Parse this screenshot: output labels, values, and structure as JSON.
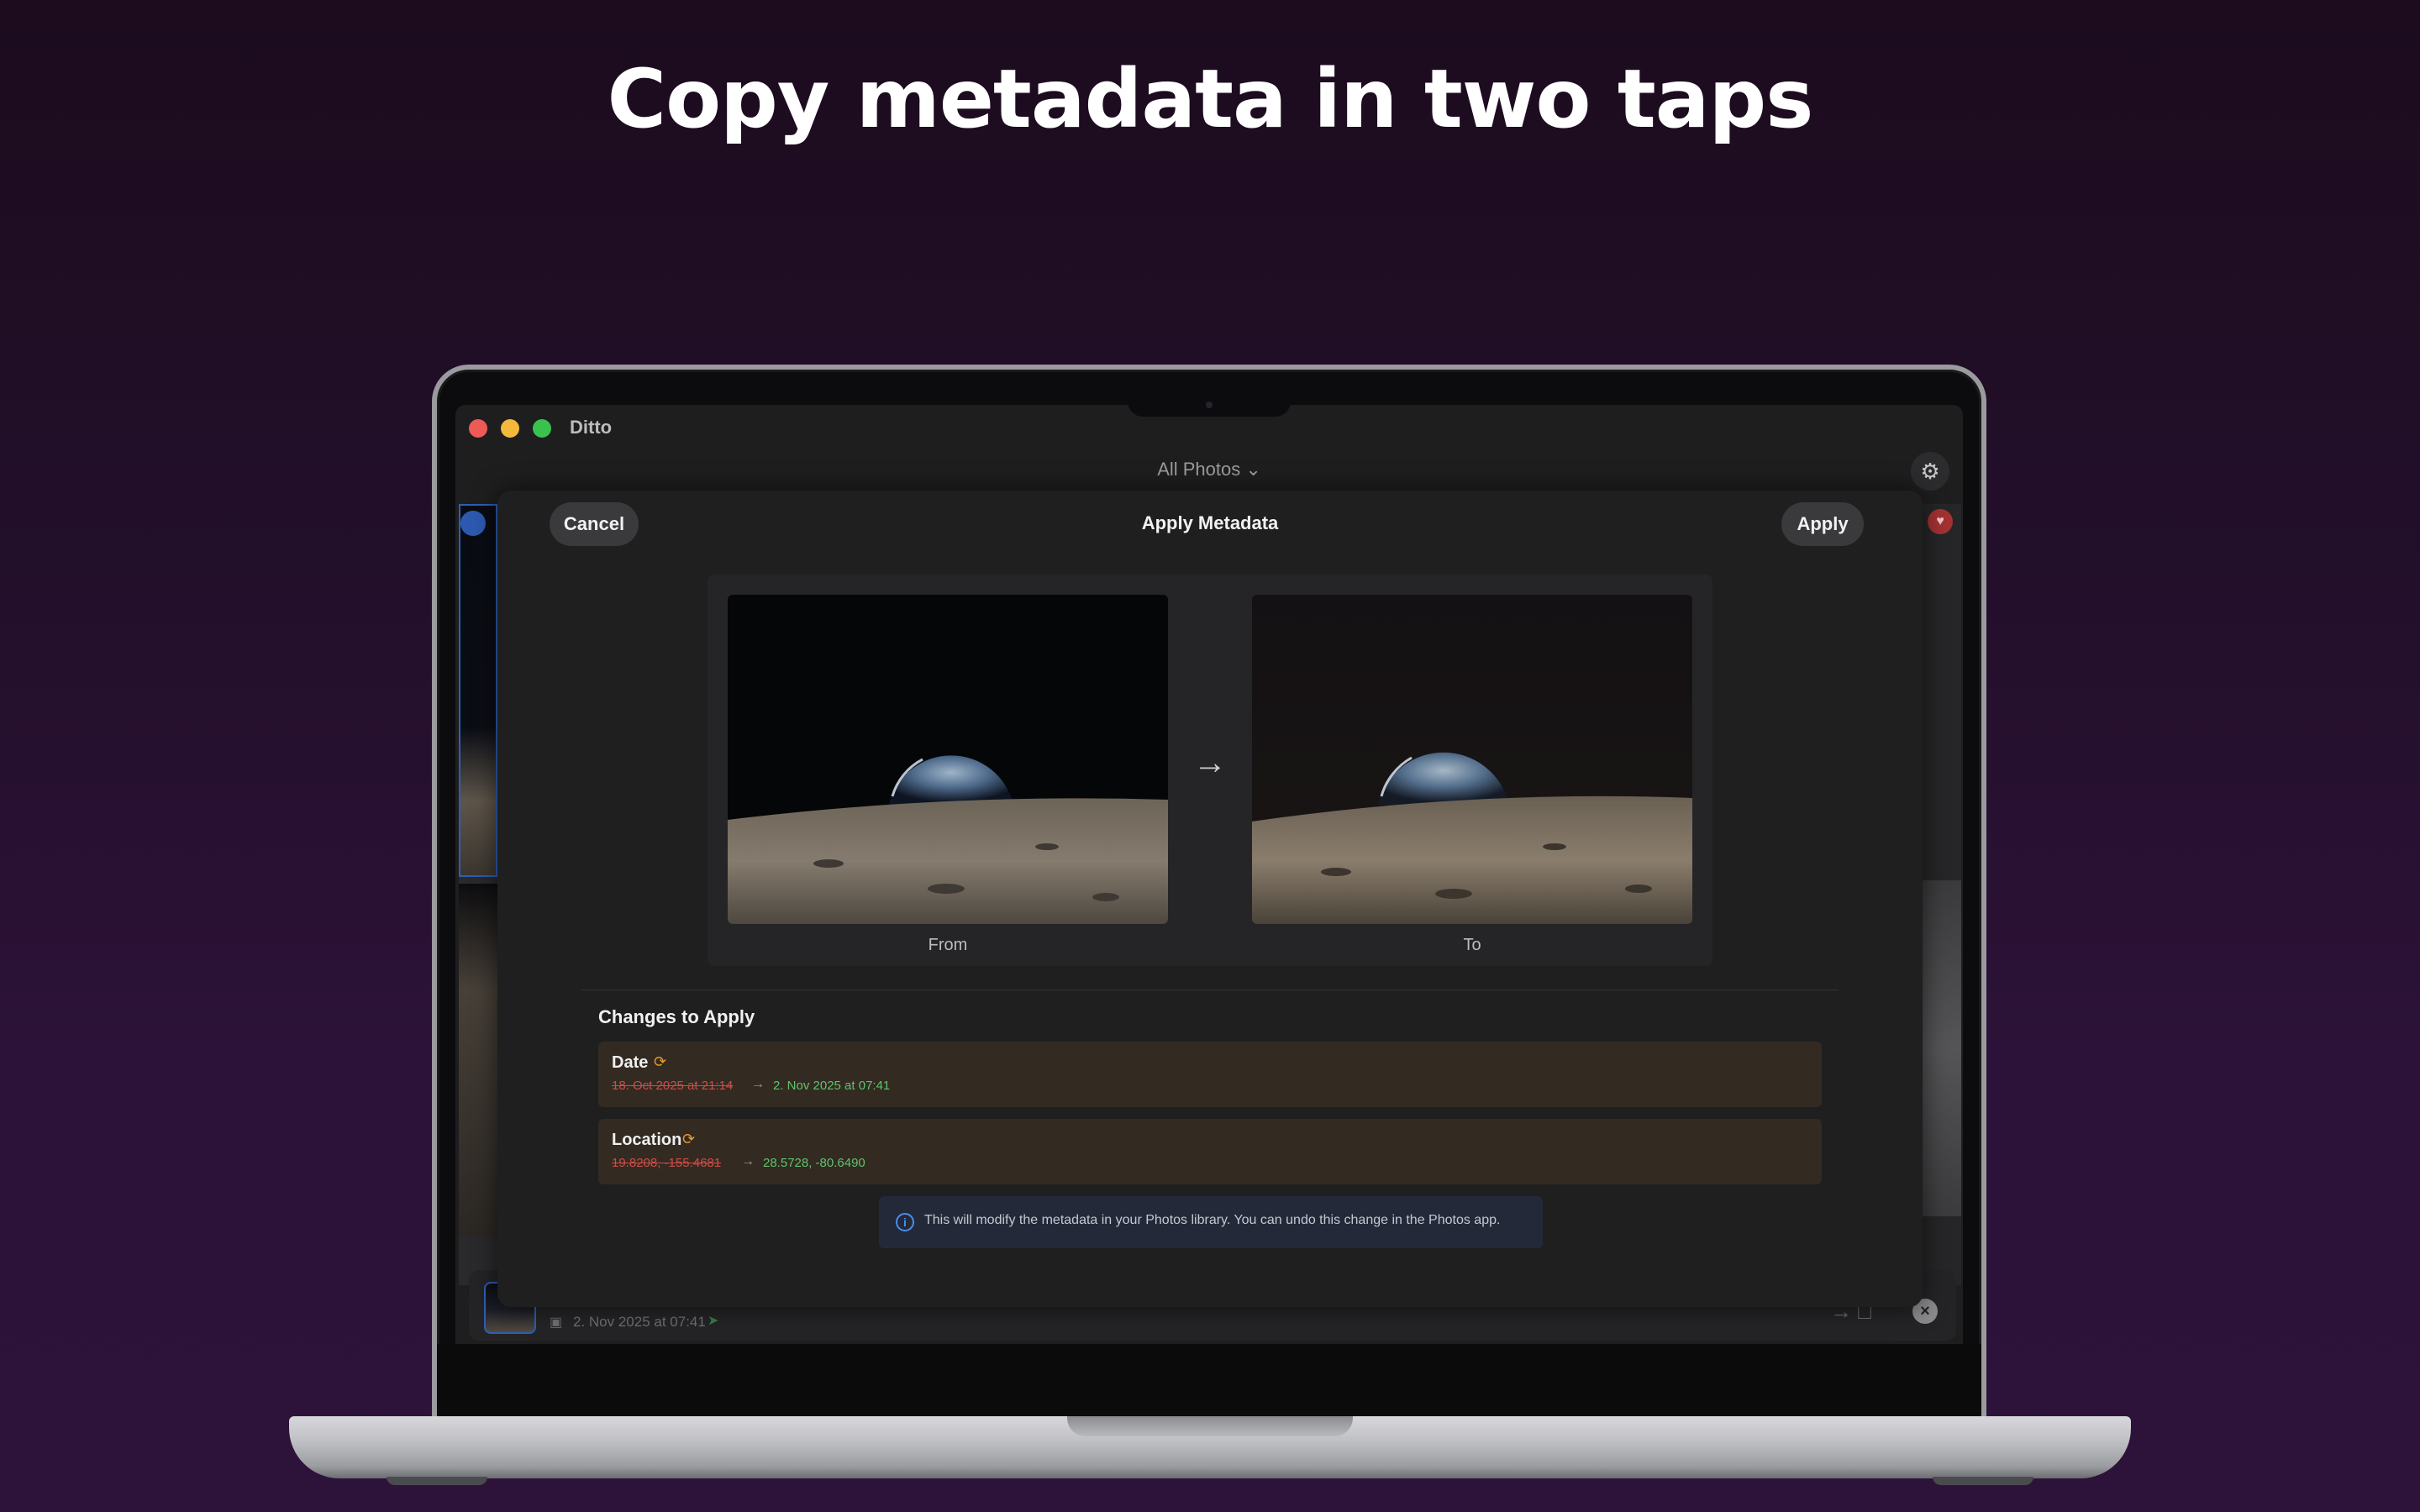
{
  "headline": "Copy metadata in two taps",
  "app": {
    "name": "Ditto",
    "toolbar_title": "All Photos",
    "toolbar_chevron": "chevron-down-icon",
    "gear_icon": "gear-icon"
  },
  "sheet": {
    "title": "Apply Metadata",
    "cancel_label": "Cancel",
    "apply_label": "Apply",
    "from_caption": "From",
    "to_caption": "To",
    "changes_title": "Changes to Apply",
    "changes": [
      {
        "label": "Date",
        "old": "18. Oct 2025 at 21:14",
        "new": "2. Nov 2025 at 07:41"
      },
      {
        "label": "Location",
        "old": "19.8208, -155.4681",
        "new": "28.5728, -80.6490"
      }
    ],
    "info_text": "This will modify the metadata in your Photos library. You can undo this change in the Photos app."
  },
  "bottom_bar": {
    "date": "2. Nov 2025 at 07:41"
  },
  "colors": {
    "background_top": "#1c0c1e",
    "background_bottom": "#2d1339",
    "old_value": "#cf4d45",
    "new_value": "#5fc36a",
    "change_row": "#332a22",
    "info_accent": "#4a8de8",
    "traffic_red": "#ee5b56",
    "traffic_yellow": "#f2b93b",
    "traffic_green": "#39c24d"
  }
}
